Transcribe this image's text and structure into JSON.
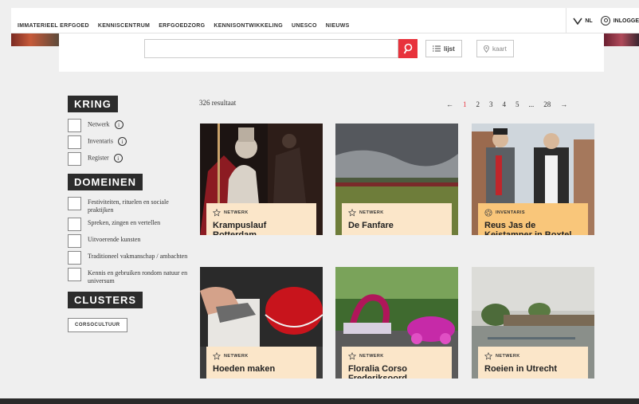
{
  "nav": {
    "links": [
      "IMMATERIEEL ERFGOED",
      "KENNISCENTRUM",
      "ERFGOEDZORG",
      "KENNISONTWIKKELING",
      "UNESCO",
      "NIEUWS"
    ],
    "language": "NL",
    "login": "INLOGGE"
  },
  "search": {
    "value": "",
    "list_label": "lijst",
    "map_label": "kaart"
  },
  "sidebar": {
    "kring": {
      "title": "KRING",
      "items": [
        "Netwerk",
        "Inventaris",
        "Register"
      ]
    },
    "domeinen": {
      "title": "DOMEINEN",
      "items": [
        "Festiviteiten, rituelen en sociale praktijken",
        "Spreken, zingen en vertellen",
        "Uitvoerende kunsten",
        "Traditioneel vakmanschap / ambachten",
        "Kennis en gebruiken rondom natuur en universum"
      ]
    },
    "clusters": {
      "title": "CLUSTERS",
      "button": "CORSOCULTUUR"
    }
  },
  "results": {
    "count": "326 resultaat",
    "pages": [
      "1",
      "2",
      "3",
      "4",
      "5",
      "...",
      "28"
    ],
    "prev": "←",
    "next": "→",
    "cards": [
      {
        "type": "NETWERK",
        "title": "Krampuslauf Rotterdam"
      },
      {
        "type": "NETWERK",
        "title": "De Fanfare"
      },
      {
        "type": "INVENTARIS",
        "title": "Reus Jas de Keistamper in Boxtel"
      },
      {
        "type": "NETWERK",
        "title": "Hoeden maken"
      },
      {
        "type": "NETWERK",
        "title": "Floralia Corso Frederiksoord"
      },
      {
        "type": "NETWERK",
        "title": "Roeien in Utrecht"
      }
    ]
  },
  "colors": {
    "accent": "#e8323c",
    "tag_netwerk": "#fbe6c9",
    "tag_inventaris": "#f9c67a"
  }
}
